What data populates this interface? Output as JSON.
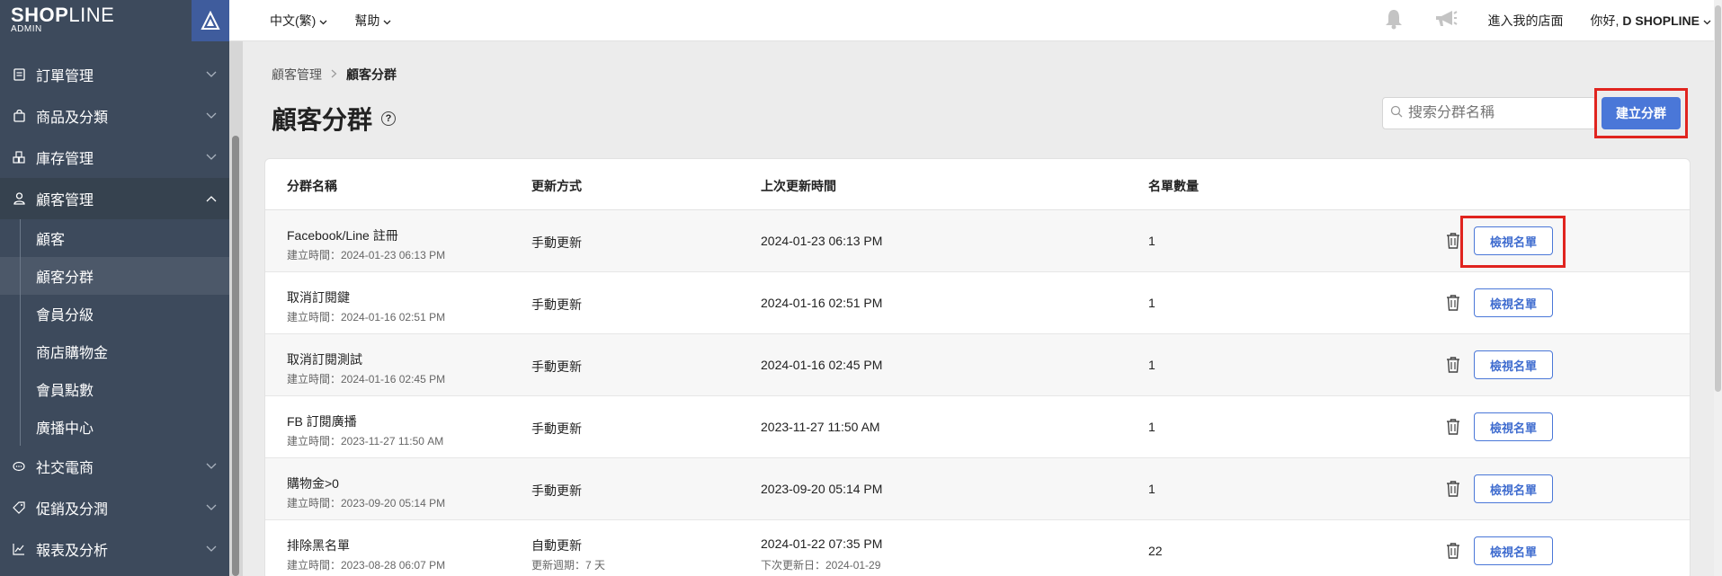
{
  "logo": {
    "brand_bold": "SHOP",
    "brand_thin": "LINE",
    "sub": "ADMIN"
  },
  "sidebar": {
    "items": [
      {
        "label": "訂單管理",
        "icon": "document-icon"
      },
      {
        "label": "商品及分類",
        "icon": "shopping-bag-icon"
      },
      {
        "label": "庫存管理",
        "icon": "boxes-icon"
      },
      {
        "label": "顧客管理",
        "icon": "user-icon",
        "expanded": true
      },
      {
        "label": "社交電商",
        "icon": "chat-bubble-icon"
      },
      {
        "label": "促銷及分潤",
        "icon": "tag-icon"
      },
      {
        "label": "報表及分析",
        "icon": "chart-icon"
      }
    ],
    "subitems": [
      "顧客",
      "顧客分群",
      "會員分級",
      "商店購物金",
      "會員點數",
      "廣播中心"
    ],
    "current_subitem": "顧客分群"
  },
  "topbar": {
    "language": "中文(繁)",
    "help": "幫助",
    "store_link": "進入我的店面",
    "greeting_prefix": "你好, ",
    "greeting_name": "D SHOPLINE"
  },
  "breadcrumb": {
    "parent": "顧客管理",
    "current": "顧客分群"
  },
  "page": {
    "title": "顧客分群"
  },
  "search": {
    "placeholder": "搜索分群名稱"
  },
  "create_button": "建立分群",
  "table": {
    "headers": [
      "分群名稱",
      "更新方式",
      "上次更新時間",
      "名單數量"
    ],
    "view_label": "檢視名單",
    "rows": [
      {
        "name": "Facebook/Line 註冊",
        "created": "建立時間：2024-01-23 06:13 PM",
        "method": "手動更新",
        "method_sub": "",
        "updated": "2024-01-23 06:13 PM",
        "updated_sub": "",
        "count": "1"
      },
      {
        "name": "取消訂閱鍵",
        "created": "建立時間：2024-01-16 02:51 PM",
        "method": "手動更新",
        "method_sub": "",
        "updated": "2024-01-16 02:51 PM",
        "updated_sub": "",
        "count": "1"
      },
      {
        "name": "取消訂閱測試",
        "created": "建立時間：2024-01-16 02:45 PM",
        "method": "手動更新",
        "method_sub": "",
        "updated": "2024-01-16 02:45 PM",
        "updated_sub": "",
        "count": "1"
      },
      {
        "name": "FB 訂閱廣播",
        "created": "建立時間：2023-11-27 11:50 AM",
        "method": "手動更新",
        "method_sub": "",
        "updated": "2023-11-27 11:50 AM",
        "updated_sub": "",
        "count": "1"
      },
      {
        "name": "購物金>0",
        "created": "建立時間：2023-09-20 05:14 PM",
        "method": "手動更新",
        "method_sub": "",
        "updated": "2023-09-20 05:14 PM",
        "updated_sub": "",
        "count": "1"
      },
      {
        "name": "排除黑名單",
        "created": "建立時間：2023-08-28 06:07 PM",
        "method": "自動更新",
        "method_sub": "更新週期：7 天",
        "updated": "2024-01-22 07:35 PM",
        "updated_sub": "下次更新日：2024-01-29",
        "count": "22"
      }
    ]
  },
  "colors": {
    "sidebar_bg": "#3d4a5c",
    "accent": "#4a77d8",
    "highlight": "#e0241f"
  }
}
